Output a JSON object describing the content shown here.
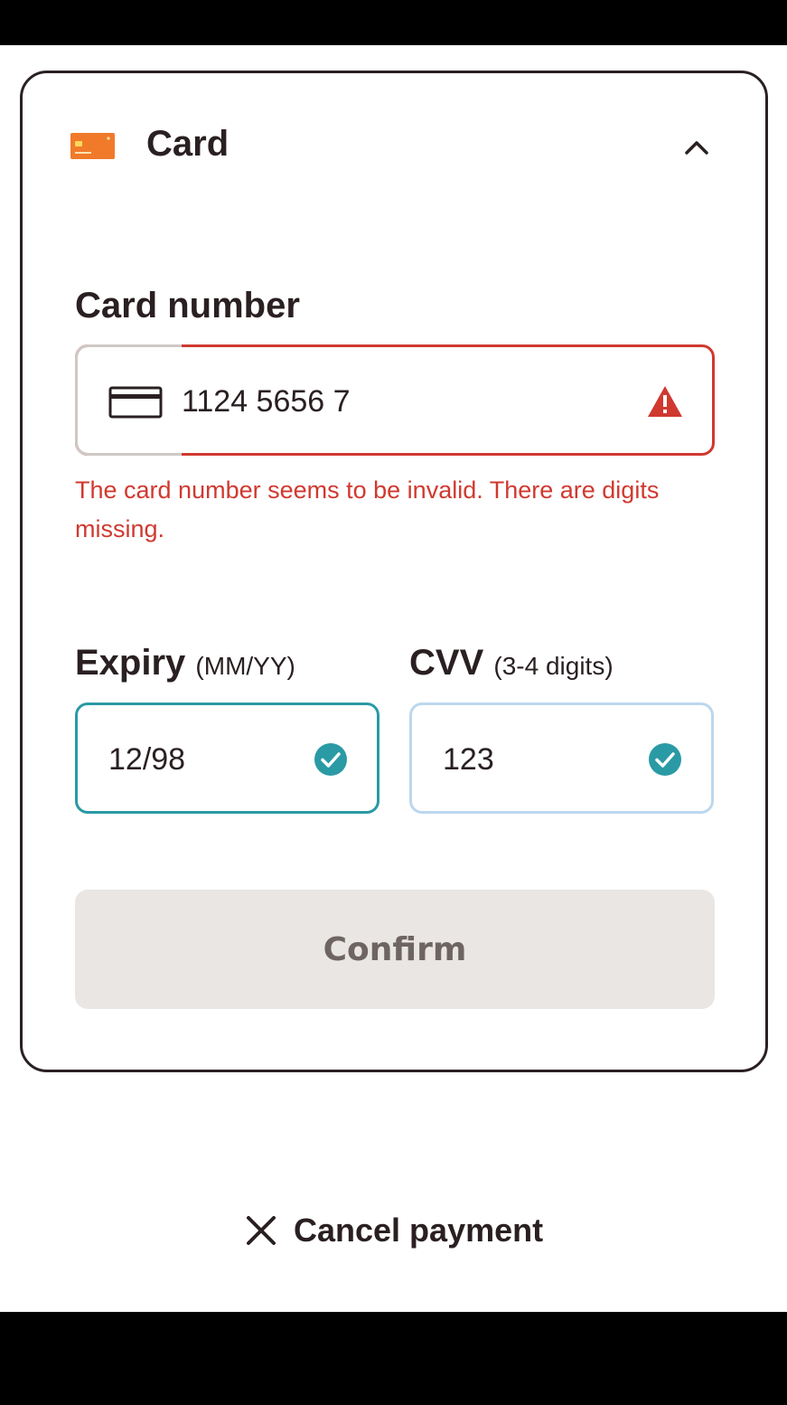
{
  "header": {
    "title": "Card",
    "logo_icon": "credit-card-logo",
    "toggle_icon": "chevron-up-icon"
  },
  "card_number": {
    "label": "Card number",
    "value": "1124 5656 7",
    "error": "The card number seems to be invalid. There are digits missing.",
    "status_icon": "warning-icon"
  },
  "expiry": {
    "label": "Expiry",
    "hint": "(MM/YY)",
    "value": "12/98",
    "status_icon": "check-circle-icon"
  },
  "cvv": {
    "label": "CVV",
    "hint": "(3-4 digits)",
    "value": "123",
    "status_icon": "check-circle-icon"
  },
  "confirm": {
    "label": "Confirm"
  },
  "cancel": {
    "label": "Cancel payment",
    "icon": "close-icon"
  },
  "colors": {
    "error": "#d0392f",
    "valid": "#2a9aa5",
    "brand_orange": "#f07a2a",
    "disabled_button_bg": "#e9e6e3",
    "disabled_button_text": "#6e6563"
  }
}
